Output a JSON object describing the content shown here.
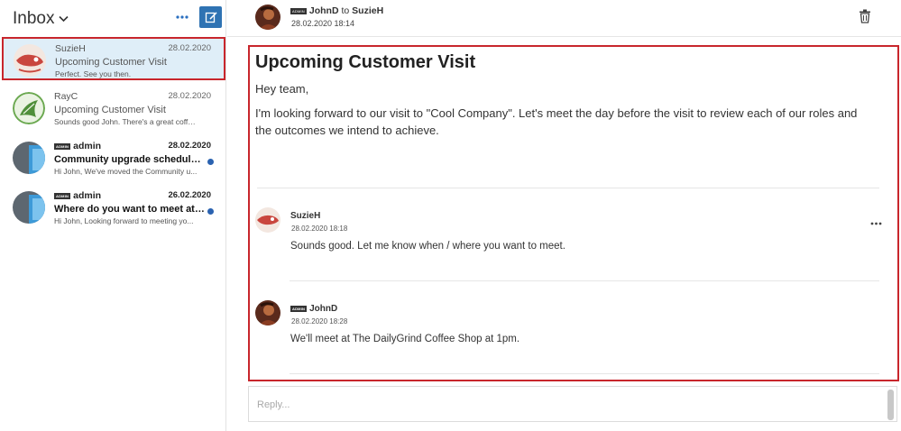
{
  "inbox": {
    "title": "Inbox",
    "conversations": [
      {
        "name": "SuzieH",
        "date": "28.02.2020",
        "subject": "Upcoming Customer Visit",
        "preview": "Perfect. See you then.",
        "admin": false,
        "unread": false,
        "selected": true
      },
      {
        "name": "RayC",
        "date": "28.02.2020",
        "subject": "Upcoming Customer Visit",
        "preview": "Sounds good John. There's a great coffee ...",
        "admin": false,
        "unread": false,
        "selected": false
      },
      {
        "name": "admin",
        "date": "28.02.2020",
        "subject": "Community upgrade schedule update",
        "preview": "Hi John,   We've moved the Community u...",
        "admin": true,
        "unread": true,
        "selected": false
      },
      {
        "name": "admin",
        "date": "26.02.2020",
        "subject": "Where do you want to meet at Khoros?",
        "preview": "Hi John,   Looking forward to meeting yo...",
        "admin": true,
        "unread": true,
        "selected": false
      }
    ]
  },
  "badge_text": "ADMIN",
  "header": {
    "from": "JohnD",
    "to_word": "to",
    "to": "SuzieH",
    "timestamp": "28.02.2020 18:14"
  },
  "thread": {
    "title": "Upcoming Customer Visit",
    "greeting": "Hey team,",
    "body": "I'm looking forward to our visit to \"Cool Company\". Let's meet the day before the visit to review each of our roles and the outcomes we intend to achieve.",
    "replies": [
      {
        "name": "SuzieH",
        "time": "28.02.2020 18:18",
        "body": "Sounds good. Let me know when / where you want to meet.",
        "admin": false
      },
      {
        "name": "JohnD",
        "time": "28.02.2020 18:28",
        "body": "We'll meet at The DailyGrind Coffee Shop at 1pm.",
        "admin": true
      }
    ]
  },
  "reply": {
    "placeholder": "Reply..."
  },
  "icons": {
    "chevron": "chevron-down-icon",
    "more": "more-horizontal-icon",
    "compose": "compose-icon",
    "trash": "trash-icon"
  },
  "colors": {
    "accent": "#2f73b3",
    "selection": "#dfeef8",
    "highlight_border": "#c8262c",
    "unread": "#2a62b0"
  }
}
